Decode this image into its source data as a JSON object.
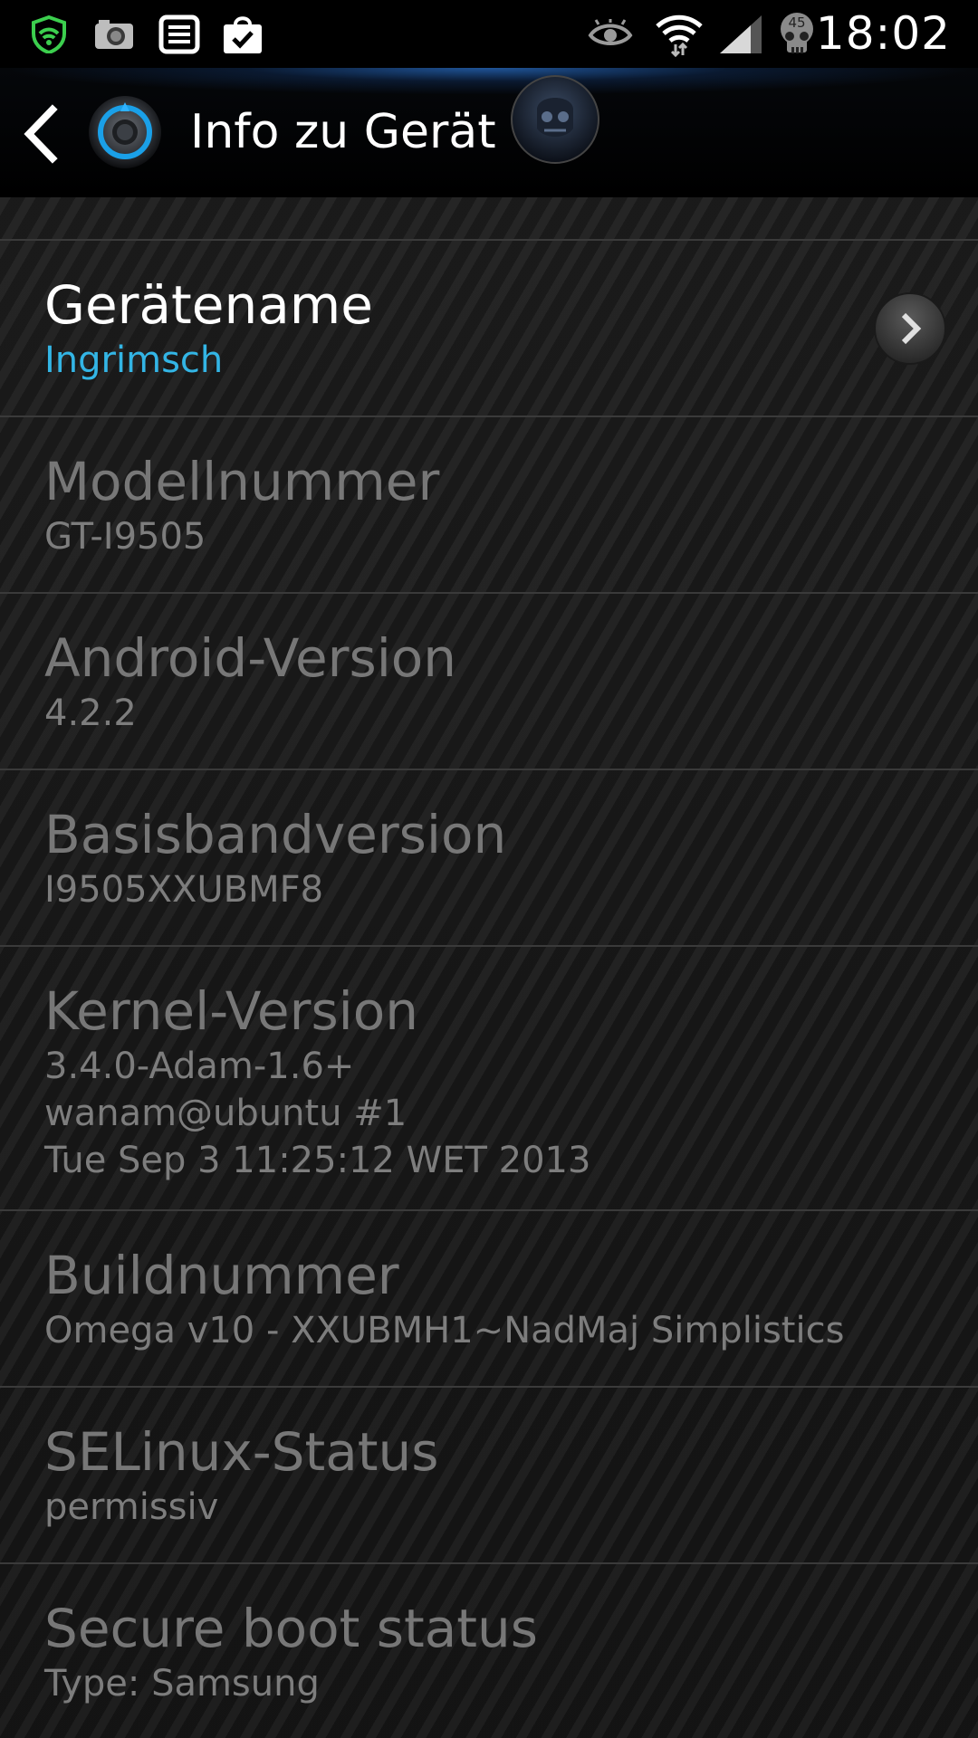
{
  "status_bar": {
    "time": "18:02",
    "icons": [
      "shield-icon",
      "camera-icon",
      "notes-icon",
      "shopping-bag-icon",
      "eye-icon",
      "wifi-icon",
      "signal-icon",
      "skull-icon"
    ],
    "skull_badge": "45"
  },
  "action_bar": {
    "title": "Info zu Gerät"
  },
  "items": [
    {
      "title": "Gerätename",
      "value": "Ingrimsch"
    },
    {
      "title": "Modellnummer",
      "value": "GT-I9505"
    },
    {
      "title": "Android-Version",
      "value": "4.2.2"
    },
    {
      "title": "Basisbandversion",
      "value": "I9505XXUBMF8"
    },
    {
      "title": "Kernel-Version",
      "lines": [
        "3.4.0-Adam-1.6+",
        "wanam@ubuntu #1",
        "Tue Sep 3 11:25:12 WET 2013"
      ]
    },
    {
      "title": "Buildnummer",
      "value": "Omega v10 - XXUBMH1~NadMaj Simplistics"
    },
    {
      "title": "SELinux-Status",
      "value": "permissiv"
    },
    {
      "title": "Secure boot status",
      "value": "Type: Samsung"
    }
  ],
  "colors": {
    "accent": "#33b5e5",
    "disabled_text": "#777777",
    "divider": "#3a3a3a"
  }
}
